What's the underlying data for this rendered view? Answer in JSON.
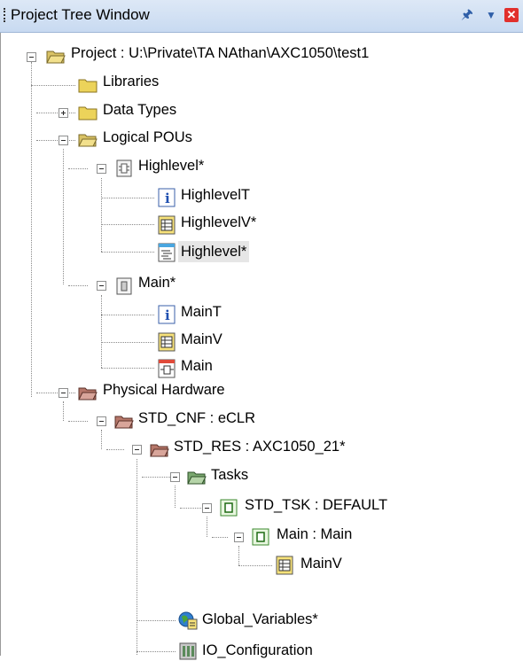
{
  "window": {
    "title": "Project Tree Window"
  },
  "tree": {
    "project": "Project : U:\\Private\\TA NAthan\\AXC1050\\test1",
    "libraries": "Libraries",
    "data_types": "Data Types",
    "logical_pous": "Logical POUs",
    "highlevel": "Highlevel*",
    "highlevel_t": "HighlevelT",
    "highlevel_v": "HighlevelV*",
    "highlevel_code": "Highlevel*",
    "main": "Main*",
    "main_t": "MainT",
    "main_v": "MainV",
    "main_code": "Main",
    "physical_hardware": "Physical Hardware",
    "std_cnf": "STD_CNF : eCLR",
    "std_res": "STD_RES : AXC1050_21*",
    "tasks": "Tasks",
    "std_tsk": "STD_TSK : DEFAULT",
    "main_instance": "Main : Main",
    "main_instance_v": "MainV",
    "global_vars": "Global_Variables*",
    "io_config": "IO_Configuration"
  }
}
